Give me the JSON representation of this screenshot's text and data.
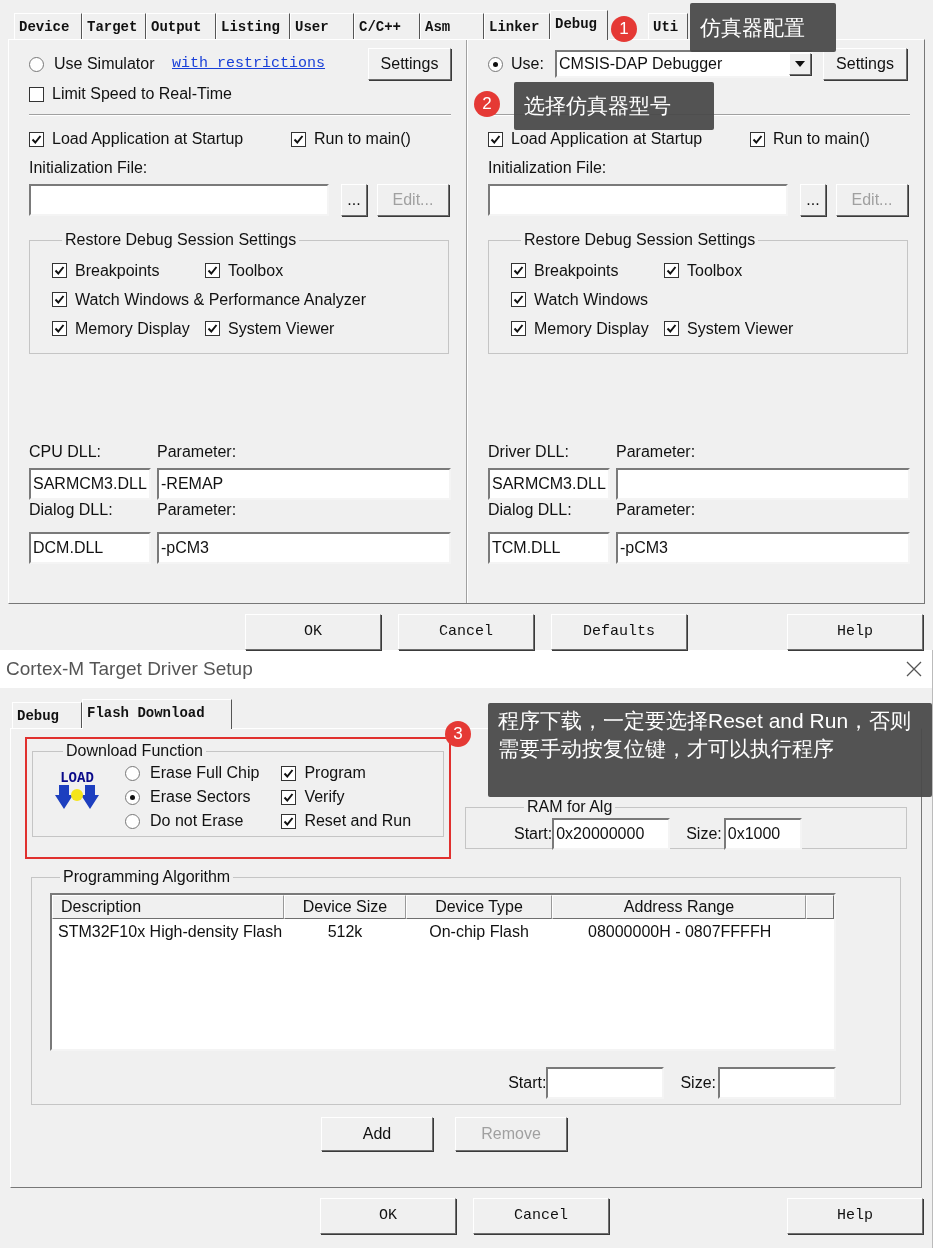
{
  "options_dialog": {
    "tabs": [
      {
        "label": "Device",
        "selected": false
      },
      {
        "label": "Target",
        "selected": false
      },
      {
        "label": "Output",
        "selected": false
      },
      {
        "label": "Listing",
        "selected": false
      },
      {
        "label": "User",
        "selected": false
      },
      {
        "label": "C/C++",
        "selected": false
      },
      {
        "label": "Asm",
        "selected": false
      },
      {
        "label": "Linker",
        "selected": false
      },
      {
        "label": "Debug",
        "selected": true
      },
      {
        "label": "Uti",
        "selected": false
      }
    ],
    "columns": [
      {
        "mode": {
          "kind": "simulator",
          "label": "Use Simulator",
          "selected": false,
          "link": "with restrictions",
          "settings": "Settings",
          "limit_speed": {
            "label": "Limit Speed to Real-Time",
            "checked": false
          }
        },
        "load_app": {
          "label": "Load Application at Startup",
          "checked": true
        },
        "run_to_main": {
          "label": "Run to main()",
          "checked": true
        },
        "init_file_label": "Initialization File:",
        "browse_button": "...",
        "edit_button": {
          "label": "Edit...",
          "disabled": true
        },
        "restore": {
          "title": "Restore Debug Session Settings",
          "rows": [
            [
              {
                "label": "Breakpoints",
                "checked": true
              },
              {
                "label": "Toolbox",
                "checked": true
              }
            ],
            [
              {
                "label": "Watch Windows & Performance Analyzer",
                "checked": true
              }
            ],
            [
              {
                "label": "Memory Display",
                "checked": true
              },
              {
                "label": "System Viewer",
                "checked": true
              }
            ]
          ]
        },
        "dll": [
          {
            "label": "CPU DLL:",
            "value": "SARMCM3.DLL",
            "param_label": "Parameter:",
            "param": "-REMAP"
          },
          {
            "label": "Dialog DLL:",
            "value": "DCM.DLL",
            "param_label": "Parameter:",
            "param": "-pCM3"
          }
        ]
      },
      {
        "mode": {
          "kind": "target",
          "label": "Use:",
          "selected": true,
          "value": "CMSIS-DAP Debugger",
          "settings": "Settings"
        },
        "load_app": {
          "label": "Load Application at Startup",
          "checked": true
        },
        "run_to_main": {
          "label": "Run to main()",
          "checked": true
        },
        "init_file_label": "Initialization File:",
        "browse_button": "...",
        "edit_button": {
          "label": "Edit...",
          "disabled": true
        },
        "restore": {
          "title": "Restore Debug Session Settings",
          "rows": [
            [
              {
                "label": "Breakpoints",
                "checked": true
              },
              {
                "label": "Toolbox",
                "checked": true
              }
            ],
            [
              {
                "label": "Watch Windows",
                "checked": true
              }
            ],
            [
              {
                "label": "Memory Display",
                "checked": true
              },
              {
                "label": "System Viewer",
                "checked": true
              }
            ]
          ]
        },
        "dll": [
          {
            "label": "Driver DLL:",
            "value": "SARMCM3.DLL",
            "param_label": "Parameter:"
          },
          {
            "label": "Dialog DLL:",
            "value": "TCM.DLL",
            "param_label": "Parameter:",
            "param": "-pCM3"
          }
        ]
      }
    ],
    "buttons": [
      "OK",
      "Cancel",
      "Defaults",
      "Help"
    ]
  },
  "driver_setup": {
    "title": "Cortex-M Target Driver Setup",
    "tabs": [
      {
        "label": "Debug",
        "selected": false
      },
      {
        "label": "Flash Download",
        "selected": true
      }
    ],
    "download_function": {
      "title": "Download Function",
      "highlighted": true,
      "icon_label": "LOAD",
      "erase": [
        {
          "label": "Erase Full Chip",
          "selected": false
        },
        {
          "label": "Erase Sectors",
          "selected": true
        },
        {
          "label": "Do not Erase",
          "selected": false
        }
      ],
      "checks": [
        {
          "label": "Program",
          "checked": true
        },
        {
          "label": "Verify",
          "checked": true
        },
        {
          "label": "Reset and Run",
          "checked": true
        }
      ]
    },
    "ram": {
      "title": "RAM for Alg",
      "start_label": "Start:",
      "start": "0x20000000",
      "size_label": "Size:",
      "size": "0x1000"
    },
    "algorithm": {
      "title": "Programming Algorithm",
      "columns": [
        "Description",
        "Device Size",
        "Device Type",
        "Address Range"
      ],
      "rows": [
        [
          "STM32F10x High-density Flash",
          "512k",
          "On-chip Flash",
          "08000000H - 0807FFFFH"
        ]
      ],
      "start_label": "Start:",
      "size_label": "Size:",
      "add_button": {
        "label": "Add",
        "disabled": false
      },
      "remove_button": {
        "label": "Remove",
        "disabled": true
      }
    },
    "buttons": [
      "OK",
      "Cancel",
      "Help"
    ]
  },
  "callouts": [
    {
      "number": "1",
      "text": "仿真器配置"
    },
    {
      "number": "2",
      "text": "选择仿真器型号"
    },
    {
      "number": "3",
      "text": "程序下载，一定要选择Reset and Run，否则需要手动按复位键，才可以执行程序"
    }
  ]
}
